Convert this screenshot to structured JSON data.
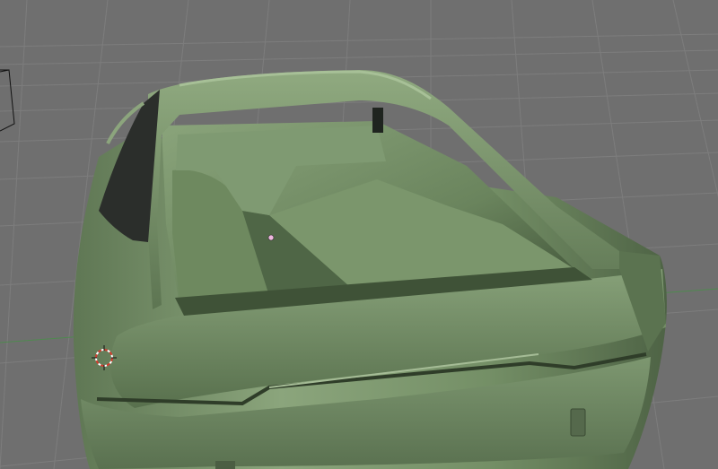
{
  "viewport": {
    "background_color": "#6f6f6f",
    "grid_color": "#7e7e7e",
    "horizon_axis_color": "#5a8a5a",
    "model_color": "#7f9a72",
    "model_shadow_color": "#3f5237",
    "glass_color": "#2b2e2b",
    "cursor_icon": "3d-cursor-icon",
    "camera_icon": "camera-object-icon"
  }
}
